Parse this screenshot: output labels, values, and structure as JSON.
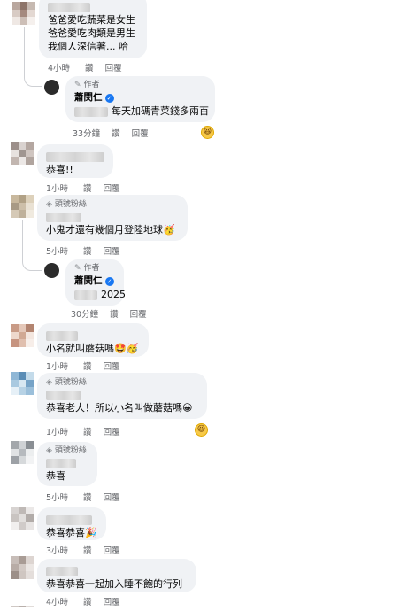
{
  "comments": {
    "c1": {
      "lines": [
        "爸爸愛吃蔬菜是女生",
        "爸爸愛吃肉類是男生",
        "我個人深信著... 哈"
      ],
      "time": "4小時",
      "like": "讚",
      "reply": "回覆"
    },
    "r1": {
      "role": "作者",
      "name": "蕭閔仁",
      "text": "每天加碼青菜錢多兩百",
      "time": "33分鐘",
      "like": "讚",
      "reply": "回覆",
      "reaction": "😆"
    },
    "c2": {
      "text": "恭喜!!",
      "time": "1小時",
      "like": "讚",
      "reply": "回覆"
    },
    "c3": {
      "badge": "頭號粉絲",
      "text": "小鬼才還有幾個月登陸地球🥳",
      "time": "5小時",
      "like": "讚",
      "reply": "回覆"
    },
    "r2": {
      "role": "作者",
      "name": "蕭閔仁",
      "text": "2025",
      "time": "30分鐘",
      "like": "讚",
      "reply": "回覆"
    },
    "c4": {
      "text": "小名就叫蘑菇嗎🤩🥳",
      "time": "1小時",
      "like": "讚",
      "reply": "回覆"
    },
    "c5": {
      "badge": "頭號粉絲",
      "text": "恭喜老大！所以小名叫做蘑菇嗎😀",
      "time": "1小時",
      "like": "讚",
      "reply": "回覆",
      "reaction": "😆"
    },
    "c6": {
      "badge": "頭號粉絲",
      "text": "恭喜",
      "time": "5小時",
      "like": "讚",
      "reply": "回覆"
    },
    "c7": {
      "text": "恭喜恭喜🎉",
      "time": "3小時",
      "like": "讚",
      "reply": "回覆"
    },
    "c8": {
      "text": "恭喜恭喜一起加入睡不飽的行列",
      "time": "4小時",
      "like": "讚",
      "reply": "回覆"
    }
  },
  "icons": {
    "badge": "diamond-icon",
    "author": "pencil-icon",
    "verified": "verified-check-icon",
    "reaction": "laughing-emoji-icon"
  },
  "colors": {
    "bubble": "#f0f2f5",
    "meta": "#65676b",
    "verified": "#1877f2"
  }
}
